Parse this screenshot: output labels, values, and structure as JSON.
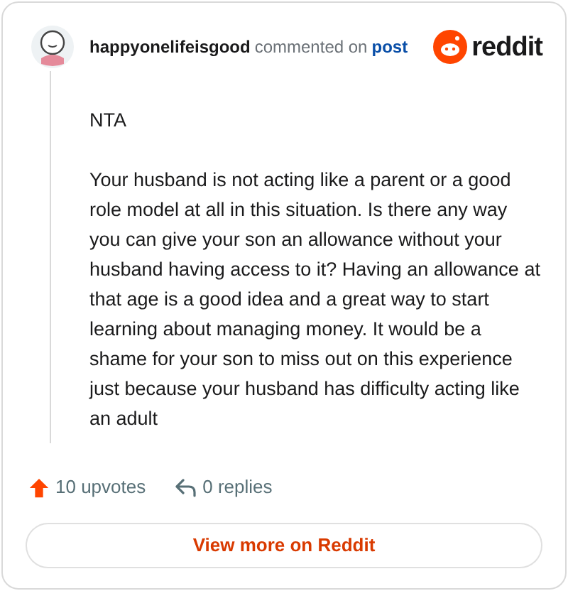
{
  "comment": {
    "author": "happyonelifeisgood",
    "action": "commented on",
    "link": "post"
  },
  "brand": {
    "wordmark": "reddit"
  },
  "body": [
    "NTA",
    "Your husband is not acting like a parent or a good role model at all in this situation. Is there any way you can give your son an allowance without your husband having access to it? Having an allowance at that age is a good idea and a great way to start learning about managing money. It would be a shame for your son to miss out on this experience just because your husband has difficulty acting like an adult"
  ],
  "stats": {
    "upvotes": "10 upvotes",
    "replies": "0 replies"
  },
  "button": {
    "label": "View more on Reddit"
  }
}
